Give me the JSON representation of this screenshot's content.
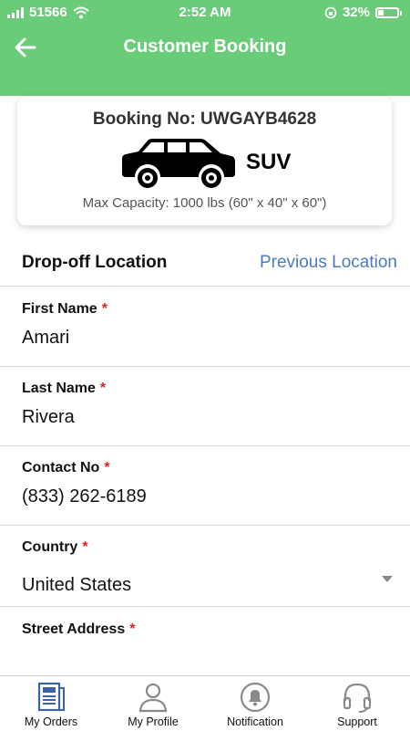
{
  "status": {
    "carrier": "51566",
    "time": "2:52 AM",
    "battery": "32%",
    "battery_level": 0.32
  },
  "header": {
    "title": "Customer Booking"
  },
  "booking": {
    "number": "Booking No: UWGAYB4628",
    "vehicle": "SUV",
    "capacity": "Max Capacity: 1000 lbs (60\" x 40\" x 60\")"
  },
  "section": {
    "title": "Drop-off Location",
    "link": "Previous Location"
  },
  "fields": [
    {
      "label": "First Name",
      "required": "*",
      "value": "Amari"
    },
    {
      "label": "Last Name",
      "required": "*",
      "value": "Rivera"
    },
    {
      "label": "Contact No",
      "required": "*",
      "value": "(833) 262-6189"
    },
    {
      "label": "Country",
      "required": "*",
      "value": "United States"
    },
    {
      "label": "Street Address",
      "required": "*",
      "value": ""
    }
  ],
  "tabs": [
    {
      "label": "My Orders",
      "icon": "orders-icon",
      "active": true
    },
    {
      "label": "My Profile",
      "icon": "profile-icon",
      "active": false
    },
    {
      "label": "Notification",
      "icon": "bell-icon",
      "active": false
    },
    {
      "label": "Support",
      "icon": "headset-icon",
      "active": false
    }
  ],
  "colors": {
    "header": "#6acb79",
    "link": "#4a7cbf",
    "required": "#e02020",
    "active_tab_icon": "#3a63a8",
    "inactive_tab_icon": "#8a8a8a"
  }
}
